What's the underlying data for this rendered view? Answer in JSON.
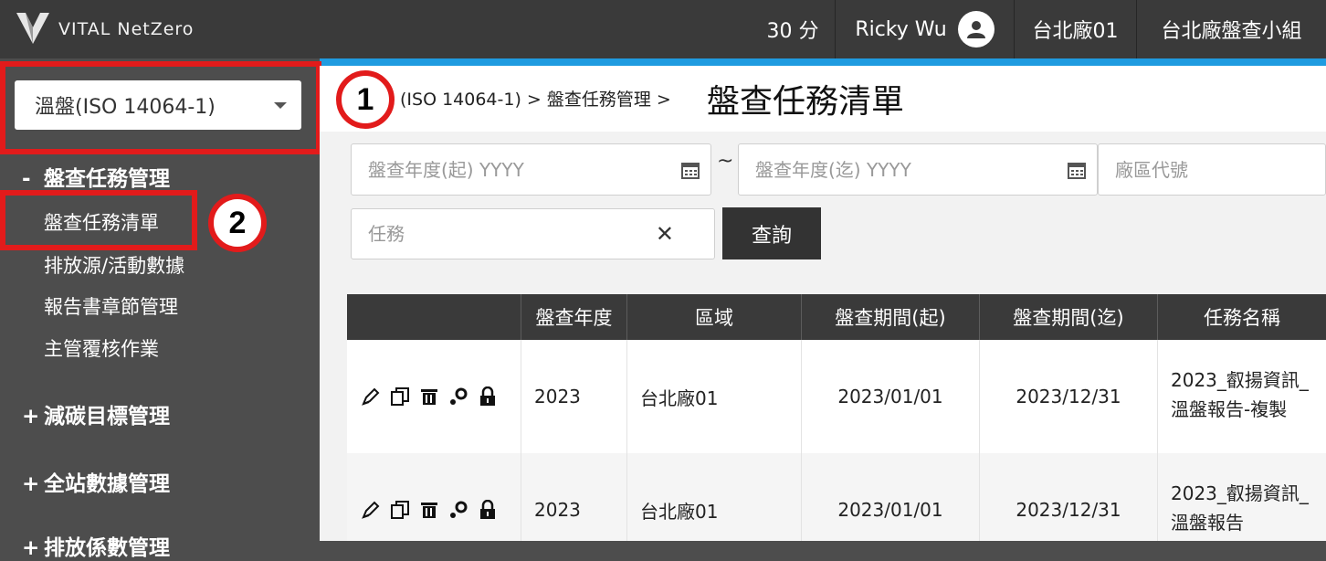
{
  "app": {
    "brand": "VITAL NetZero"
  },
  "header": {
    "score": "30 分",
    "user_name": "Ricky Wu",
    "plant": "台北廠01",
    "group": "台北廠盤查小組"
  },
  "sidebar": {
    "module_select": "溫盤(ISO 14064-1)",
    "groups": [
      {
        "symbol": "-",
        "label": "盤查任務管理",
        "items": [
          "盤查任務清單",
          "排放源/活動數據",
          "報告書章節管理",
          "主管覆核作業"
        ]
      },
      {
        "symbol": "+",
        "label": "減碳目標管理"
      },
      {
        "symbol": "+",
        "label": "全站數據管理"
      },
      {
        "symbol": "+",
        "label": "排放係數管理"
      }
    ]
  },
  "annotations": {
    "one": "1",
    "two": "2"
  },
  "breadcrumb": {
    "path": "(ISO 14064-1) > 盤查任務管理 >",
    "title": "盤查任務清單"
  },
  "filters": {
    "year_start_placeholder": "盤查年度(起) YYYY",
    "tilde": "~",
    "year_end_placeholder": "盤查年度(迄) YYYY",
    "plant_code_placeholder": "廠區代號",
    "task_placeholder": "任務",
    "clear": "✕",
    "query_label": "查詢"
  },
  "table": {
    "headers": [
      "",
      "盤查年度",
      "區域",
      "盤查期間(起)",
      "盤查期間(迄)",
      "任務名稱"
    ],
    "rows": [
      {
        "year": "2023",
        "region": "台北廠01",
        "start": "2023/01/01",
        "end": "2023/12/31",
        "name_line1": "2023_叡揚資訊_",
        "name_line2": "溫盤報告-複製"
      },
      {
        "year": "2023",
        "region": "台北廠01",
        "start": "2023/01/01",
        "end": "2023/12/31",
        "name_line1": "2023_叡揚資訊_",
        "name_line2": "溫盤報告"
      }
    ]
  },
  "colors": {
    "accent": "#1f9be0",
    "highlight": "#e21b1b",
    "topbar": "#3a3a3a",
    "sidebar": "#4d4d4d"
  },
  "icons": [
    "logo-icon",
    "user-avatar-icon",
    "dropdown-caret-icon",
    "calendar-icon",
    "clear-icon",
    "edit-icon",
    "copy-icon",
    "delete-icon",
    "settings-icon",
    "lock-icon"
  ]
}
